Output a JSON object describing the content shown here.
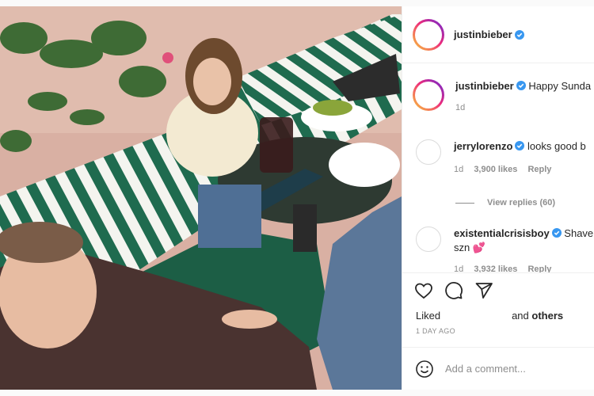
{
  "post": {
    "author": "justinbieber",
    "photo_alt": "Photo by justinbieber"
  },
  "comments": [
    {
      "username": "justinbieber",
      "text": "Happy Sunda",
      "time": "1d",
      "likes": "",
      "reply": ""
    },
    {
      "username": "jerrylorenzo",
      "text": "looks good b",
      "time": "1d",
      "likes": "3,900 likes",
      "reply": "Reply"
    },
    {
      "username": "existentialcrisisboy",
      "text": "Shave",
      "text2": "szn 💕",
      "time": "1d",
      "likes": "3,932 likes",
      "reply": "Reply"
    }
  ],
  "view_replies": "View replies (60)",
  "likes": {
    "prefix": "Liked",
    "suffix": "and",
    "others": "others"
  },
  "timestamp": "1 DAY AGO",
  "add_comment": {
    "placeholder": "Add a comment..."
  },
  "colors": {
    "verified": "#3897f0",
    "text": "#262626",
    "muted": "#8e8e8e"
  },
  "icons": [
    "heart-icon",
    "comment-icon",
    "share-icon",
    "emoji-icon",
    "verified-icon"
  ]
}
